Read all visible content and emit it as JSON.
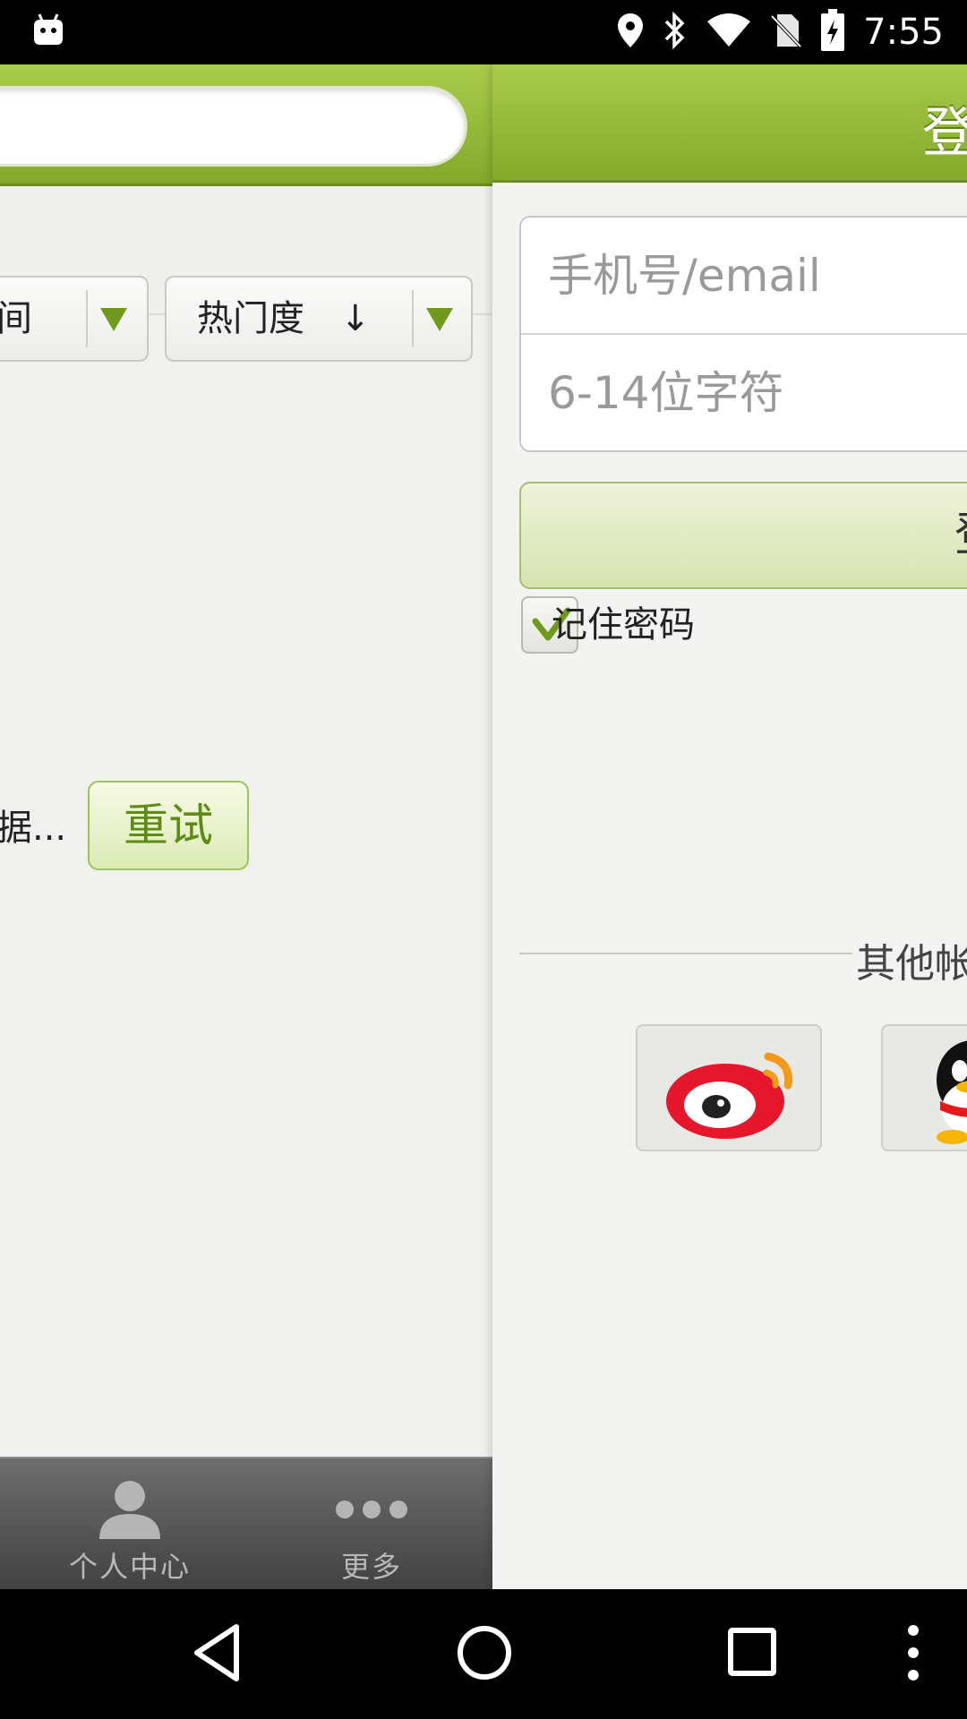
{
  "status_bar": {
    "time": "7:55",
    "icons": [
      "android-notification-icon",
      "location-icon",
      "bluetooth-icon",
      "wifi-icon",
      "no-sim-icon",
      "battery-charging-icon"
    ]
  },
  "left_panel": {
    "filters": {
      "first_label": "间",
      "sort_label": "热门度　↓"
    },
    "loading_text": "据...",
    "retry_label": "重试",
    "bottom_nav": [
      {
        "label": "个人中心",
        "icon": "person-icon"
      },
      {
        "label": "更多",
        "icon": "more-dots-icon"
      }
    ]
  },
  "login_panel": {
    "title": "登",
    "account_placeholder": "手机号/email",
    "password_placeholder": "6-14位字符",
    "login_label": "登",
    "remember_label": "记住密码",
    "remember_checked": true,
    "other_accounts_label": "其他帐",
    "social_logins": [
      "weibo-icon",
      "qq-icon"
    ]
  },
  "colors": {
    "header_green": "#95b93a",
    "accent_green": "#6f9a1e",
    "bottom_nav": "#555555"
  }
}
